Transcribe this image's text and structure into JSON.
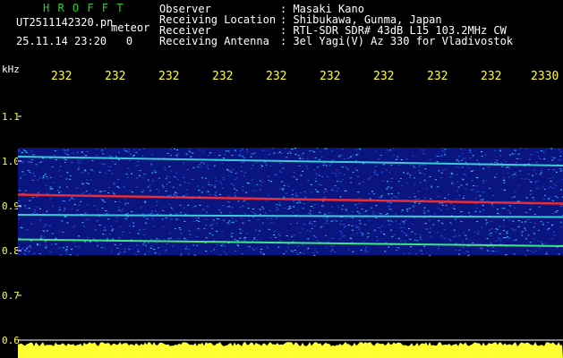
{
  "header": {
    "logo": "H R O F F T",
    "filename": "UT2511142320.pn",
    "meteor_label": "meteor",
    "datetime": "25.11.14 23:20",
    "counter": "0"
  },
  "info": [
    {
      "label": "Observer",
      "value": ": Masaki Kano"
    },
    {
      "label": "Receiving Location",
      "value": ": Shibukawa, Gunma, Japan"
    },
    {
      "label": "Receiver",
      "value": ": RTL-SDR SDR# 43dB L15 103.2MHz CW"
    },
    {
      "label": "Receiving Antenna",
      "value": ": 3el Yagi(V) Az 330 for Vladivostok"
    }
  ],
  "axis": {
    "y_unit": "kHz",
    "x_ticks": [
      "232",
      "232",
      "232",
      "232",
      "232",
      "232",
      "232",
      "232",
      "232",
      "2330"
    ],
    "y_ticks": [
      "1.1",
      "1.0",
      "0.9",
      "0.8",
      "0.7",
      "0.6"
    ]
  },
  "colors": {
    "label_green": "#22d322",
    "text": "#ffffff",
    "axis": "#ffff33",
    "band_bg": "#0b1580",
    "trace_red": "#ff3030",
    "trace_cyan": "#40e0e0",
    "trace_green": "#40ff80",
    "noise_floor": "#ffff33"
  },
  "chart_data": {
    "type": "heatmap",
    "y_unit": "kHz",
    "ylim": [
      0.6,
      1.15
    ],
    "band_range": [
      0.79,
      1.03
    ],
    "traces": [
      {
        "color": "cyan",
        "freq_start": 1.01,
        "freq_end": 0.99
      },
      {
        "color": "red",
        "freq_start": 0.925,
        "freq_end": 0.905
      },
      {
        "color": "cyan",
        "freq_start": 0.88,
        "freq_end": 0.875
      },
      {
        "color": "green",
        "freq_start": 0.825,
        "freq_end": 0.81
      }
    ],
    "noise_floor_level": 0.6
  }
}
